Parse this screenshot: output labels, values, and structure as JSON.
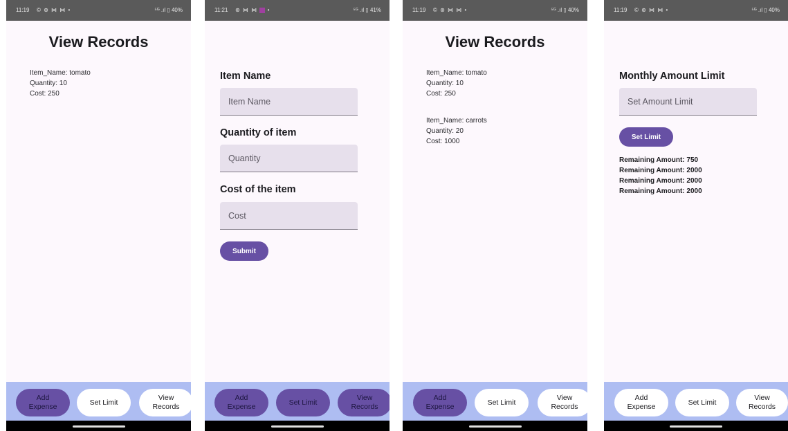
{
  "phones": [
    {
      "status": {
        "time": "11:19",
        "icons": "© ⊛ ⋈ ⋈ •",
        "right": "⁵ᴳ .ıl ▯ 40%"
      },
      "heading": "View Records",
      "records": [
        {
          "name": "Item_Name: tomato",
          "quantity": "Quantity: 10",
          "cost": "Cost: 250"
        }
      ],
      "nav": {
        "add": "Add\nExpense",
        "limit": "Set Limit",
        "view": "View\nRecords",
        "active": "add"
      }
    },
    {
      "status": {
        "time": "11:21",
        "icons": "⊛ ⋈ ⋈",
        "right": "⁵ᴳ .ıl ▯ 41%"
      },
      "form": {
        "item_label": "Item Name",
        "item_placeholder": "Item Name",
        "qty_label": "Quantity of item",
        "qty_placeholder": "Quantity",
        "cost_label": "Cost of the item",
        "cost_placeholder": "Cost",
        "submit": "Submit"
      },
      "nav": {
        "add": "Add\nExpense",
        "limit": "Set Limit",
        "view": "View\nRecords",
        "active": "all"
      }
    },
    {
      "status": {
        "time": "11:19",
        "icons": "© ⊛ ⋈ ⋈ •",
        "right": "⁵ᴳ .ıl ▯ 40%"
      },
      "heading": "View Records",
      "records": [
        {
          "name": "Item_Name: tomato",
          "quantity": "Quantity: 10",
          "cost": "Cost: 250"
        },
        {
          "name": "Item_Name: carrots",
          "quantity": "Quantity: 20",
          "cost": "Cost: 1000"
        }
      ],
      "nav": {
        "add": "Add\nExpense",
        "limit": "Set Limit",
        "view": "View\nRecords",
        "active": "add"
      }
    },
    {
      "status": {
        "time": "11:19",
        "icons": "© ⊛ ⋈ ⋈ •",
        "right": "⁵ᴳ .ıl ▯ 40%"
      },
      "limit": {
        "label": "Monthly Amount Limit",
        "placeholder": "Set Amount Limit",
        "button": "Set Limit",
        "remaining": [
          "Remaining Amount: 750",
          "Remaining Amount: 2000",
          "Remaining Amount: 2000",
          "Remaining Amount: 2000"
        ]
      },
      "nav": {
        "add": "Add\nExpense",
        "limit": "Set Limit",
        "view": "View\nRecords",
        "active": "none"
      }
    }
  ],
  "colors": {
    "primary": "#6750a4",
    "bottom_bar": "#aebdf2",
    "input_bg": "#e7e0ec",
    "background": "#fdf8fd",
    "status_bar": "#5a5a5a"
  },
  "icons": {
    "status_left": [
      "whatsapp-icon",
      "settings-icon",
      "mail-icon",
      "mail-icon",
      "dot-icon"
    ],
    "status_right": [
      "5g-icon",
      "signal-icon",
      "battery-icon"
    ]
  }
}
